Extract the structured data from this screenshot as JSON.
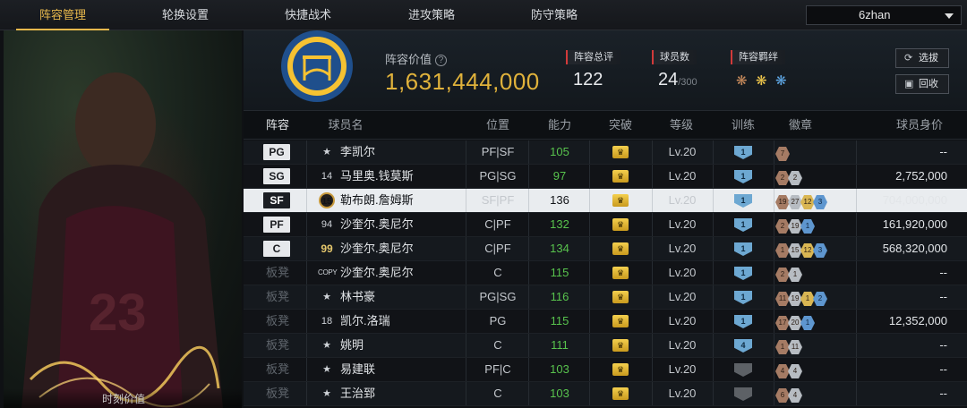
{
  "nav": {
    "tabs": [
      "阵容管理",
      "轮换设置",
      "快捷战术",
      "进攻策略",
      "防守策略"
    ],
    "active_tab": 0,
    "team_select": "6zhan"
  },
  "card": {
    "caption": "时刻价值"
  },
  "summary": {
    "value_label": "阵容价值",
    "help_icon": "?",
    "value": "1,631,444,000",
    "overall_label": "阵容总评",
    "overall": "122",
    "players_label": "球员数",
    "players_count": "24",
    "players_max": "/300",
    "bonds_label": "阵容羁绊",
    "buttons": [
      "选拔",
      "回收"
    ]
  },
  "table": {
    "headers": [
      "阵容",
      "球员名",
      "位置",
      "能力",
      "突破",
      "等级",
      "训练",
      "徽章",
      "球员身价"
    ],
    "rows": [
      {
        "slot": "PG",
        "jersey": "★",
        "name": "李凯尔",
        "position": "PF|SF",
        "ability": "105",
        "level": "Lv.20",
        "training": "1",
        "badges": [
          [
            "7",
            "bronze"
          ]
        ],
        "price": "--"
      },
      {
        "slot": "SG",
        "jersey": "14",
        "name": "马里奥.钱莫斯",
        "position": "PG|SG",
        "ability": "97",
        "level": "Lv.20",
        "training": "1",
        "badges": [
          [
            "2",
            "bronze"
          ],
          [
            "2",
            "silver"
          ]
        ],
        "price": "2,752,000"
      },
      {
        "slot": "SF",
        "jersey": "15",
        "name": "勒布朗.詹姆斯",
        "position": "SF|PF",
        "ability": "136",
        "level": "Lv.20",
        "training": "1",
        "badges": [
          [
            "19",
            "bronze"
          ],
          [
            "27",
            "silver"
          ],
          [
            "12",
            "gold"
          ],
          [
            "3",
            "blue"
          ]
        ],
        "price": "704,000,000"
      },
      {
        "slot": "PF",
        "jersey": "94",
        "name": "沙奎尔.奥尼尔",
        "position": "C|PF",
        "ability": "132",
        "level": "Lv.20",
        "training": "1",
        "badges": [
          [
            "2",
            "bronze"
          ],
          [
            "19",
            "silver"
          ],
          [
            "1",
            "blue"
          ]
        ],
        "price": "161,920,000"
      },
      {
        "slot": "C",
        "jersey": "99",
        "name": "沙奎尔.奥尼尔",
        "position": "C|PF",
        "ability": "134",
        "level": "Lv.20",
        "training": "1",
        "badges": [
          [
            "1",
            "bronze"
          ],
          [
            "15",
            "silver"
          ],
          [
            "12",
            "gold"
          ],
          [
            "3",
            "blue"
          ]
        ],
        "price": "568,320,000"
      },
      {
        "slot": "板凳",
        "jersey": "COPY",
        "name": "沙奎尔.奥尼尔",
        "position": "C",
        "ability": "115",
        "level": "Lv.20",
        "training": "1",
        "badges": [
          [
            "2",
            "bronze"
          ],
          [
            "1",
            "silver"
          ]
        ],
        "price": "--"
      },
      {
        "slot": "板凳",
        "jersey": "★",
        "name": "林书豪",
        "position": "PG|SG",
        "ability": "116",
        "level": "Lv.20",
        "training": "1",
        "badges": [
          [
            "11",
            "bronze"
          ],
          [
            "19",
            "silver"
          ],
          [
            "1",
            "gold"
          ],
          [
            "2",
            "blue"
          ]
        ],
        "price": "--"
      },
      {
        "slot": "板凳",
        "jersey": "18",
        "name": "凯尔.洛瑞",
        "position": "PG",
        "ability": "115",
        "level": "Lv.20",
        "training": "1",
        "badges": [
          [
            "17",
            "bronze"
          ],
          [
            "20",
            "silver"
          ],
          [
            "1",
            "blue"
          ]
        ],
        "price": "12,352,000"
      },
      {
        "slot": "板凳",
        "jersey": "★",
        "name": "姚明",
        "position": "C",
        "ability": "111",
        "level": "Lv.20",
        "training": "4",
        "badges": [
          [
            "1",
            "bronze"
          ],
          [
            "11",
            "silver"
          ]
        ],
        "price": "--"
      },
      {
        "slot": "板凳",
        "jersey": "★",
        "name": "易建联",
        "position": "PF|C",
        "ability": "103",
        "level": "Lv.20",
        "training": "",
        "badges": [
          [
            "4",
            "bronze"
          ],
          [
            "4",
            "silver"
          ]
        ],
        "price": "--"
      },
      {
        "slot": "板凳",
        "jersey": "★",
        "name": "王治郅",
        "position": "C",
        "ability": "103",
        "level": "Lv.20",
        "training": "",
        "badges": [
          [
            "6",
            "bronze"
          ],
          [
            "4",
            "silver"
          ]
        ],
        "price": "--"
      }
    ]
  },
  "colors": {
    "accent_gold": "#e0b23b",
    "ability_green": "#58c34d",
    "tab_active": "#e7b84c"
  },
  "icons": [
    "help-icon",
    "crown-icon",
    "training-shield-icon",
    "badge-icon",
    "star-icon",
    "dropdown-caret-icon",
    "refresh-icon",
    "recycle-icon",
    "team-logo-icon",
    "bond-icon"
  ]
}
